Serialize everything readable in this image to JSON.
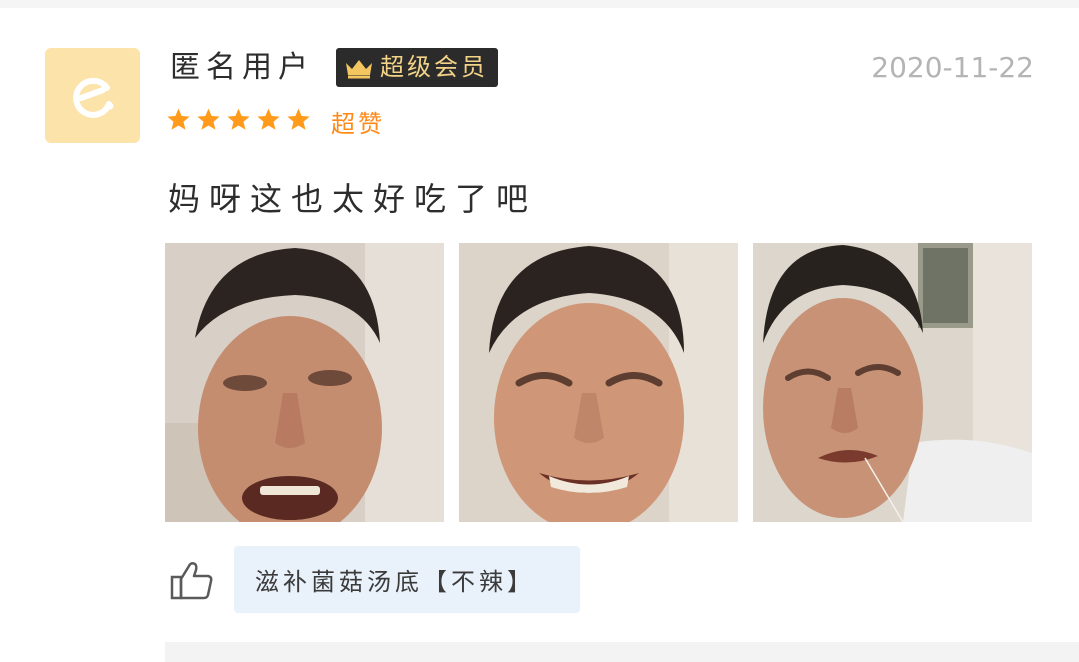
{
  "review": {
    "username": "匿名用户",
    "member_badge": "超级会员",
    "date": "2020-11-22",
    "rating": {
      "stars": 5,
      "max": 5,
      "label": "超赞",
      "star_color": "#ff9a1a"
    },
    "text": "妈呀这也太好吃了吧",
    "photos": [
      {
        "icon": "review-photo-1"
      },
      {
        "icon": "review-photo-2"
      },
      {
        "icon": "review-photo-3"
      }
    ],
    "liked_dish": "滋补菌菇汤底【不辣】"
  },
  "colors": {
    "avatar_bg": "#fbe3a9",
    "badge_bg": "#2b2b2b",
    "badge_text": "#f3d387",
    "rating_label": "#ff8a1a",
    "date_text": "#b4b4b4",
    "dish_tag_bg": "#e9f1fb"
  }
}
